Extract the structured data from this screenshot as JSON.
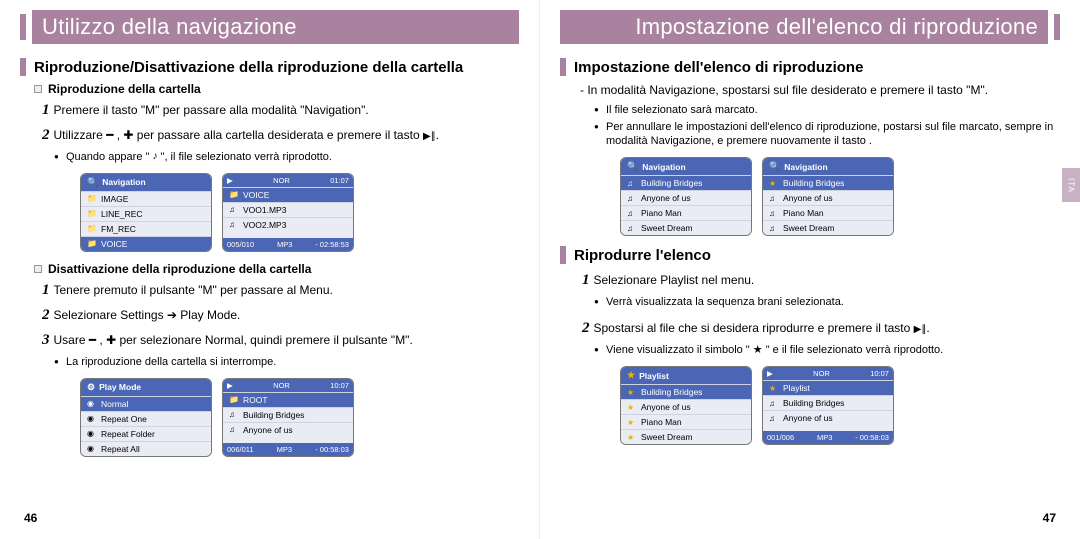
{
  "left": {
    "title": "Utilizzo della navigazione",
    "h2": "Riproduzione/Disattivazione della riproduzione della cartella",
    "sub1": "Riproduzione della cartella",
    "s1": "Premere il tasto \"M\" per passare alla modalità \"Navigation\".",
    "s2a": "Utilizzare ",
    "s2b": " per passare alla cartella desiderata e premere il tasto ",
    "b1a": "Quando appare \" ",
    "b1b": " \", il file selezionato verrà riprodotto.",
    "nav_title": "Navigation",
    "nav_items": [
      "IMAGE",
      "LINE_REC",
      "FM_REC",
      "VOICE"
    ],
    "rhs_items": [
      "VOICE",
      "VOO1.MP3",
      "VOO2.MP3"
    ],
    "rhs_top_r": "01:07",
    "rhs_counter": "005/010",
    "rhs_time": "- 02:58:53",
    "sub2": "Disattivazione della riproduzione della cartella",
    "d1": "Tenere premuto il pulsante \"M\" per passare al Menu.",
    "d2": "Selezionare Settings ➔ Play Mode.",
    "d3a": "Usare ",
    "d3b": " per selezionare Normal, quindi premere il pulsante \"M\".",
    "db1": "La riproduzione della cartella si interrompe.",
    "pm_title": "Play Mode",
    "pm_items": [
      "Normal",
      "Repeat One",
      "Repeat Folder",
      "Repeat All"
    ],
    "rhs2_items": [
      "ROOT",
      "Building Bridges",
      "Anyone of us"
    ],
    "rhs2_top_r": "10:07",
    "rhs2_counter": "006/011",
    "rhs2_time": "- 00:58:03",
    "page": "46"
  },
  "right": {
    "title": "Impostazione dell'elenco di riproduzione",
    "h2": "Impostazione dell'elenco di riproduzione",
    "dash": "- In modalità Navigazione, spostarsi sul file desiderato e premere il tasto \"M\".",
    "b1": "Il file selezionato sarà marcato.",
    "b2": "Per annullare le impostazioni dell'elenco di riproduzione, postarsi sul file marcato, sempre in modalità Navigazione, e premere nuovamente il tasto            .",
    "nav_title": "Navigation",
    "nav_items": [
      "Building Bridges",
      "Anyone of us",
      "Piano Man",
      "Sweet Dream"
    ],
    "h2b": "Riprodurre l'elenco",
    "r1": "Selezionare Playlist nel menu.",
    "rb1": "Verrà visualizzata la sequenza brani selezionata.",
    "r2a": "Spostarsi al file che si desidera riprodurre e premere il tasto ",
    "rb2": "Viene visualizzato il simbolo \" ★ \" e il file selezionato verrà riprodotto.",
    "pl_title": "Playlist",
    "pl_items": [
      "Building Bridges",
      "Anyone of us",
      "Piano Man",
      "Sweet Dream"
    ],
    "pl2_items": [
      "Playlist",
      "Building Bridges",
      "Anyone of us"
    ],
    "pl2_top_r": "10:07",
    "pl2_counter": "001/006",
    "pl2_time": "- 00:58:03",
    "tab": "ITA",
    "page": "47"
  },
  "glyph": {
    "minus_plus": "━ , ✚",
    "play_pause": "▶∥",
    "note": "♪",
    "folder": "📁",
    "music": "♫",
    "gear": "⚙",
    "radio": "◉",
    "star": "★",
    "search": "🔍",
    "play": "▶",
    "mp3": "MP3"
  }
}
